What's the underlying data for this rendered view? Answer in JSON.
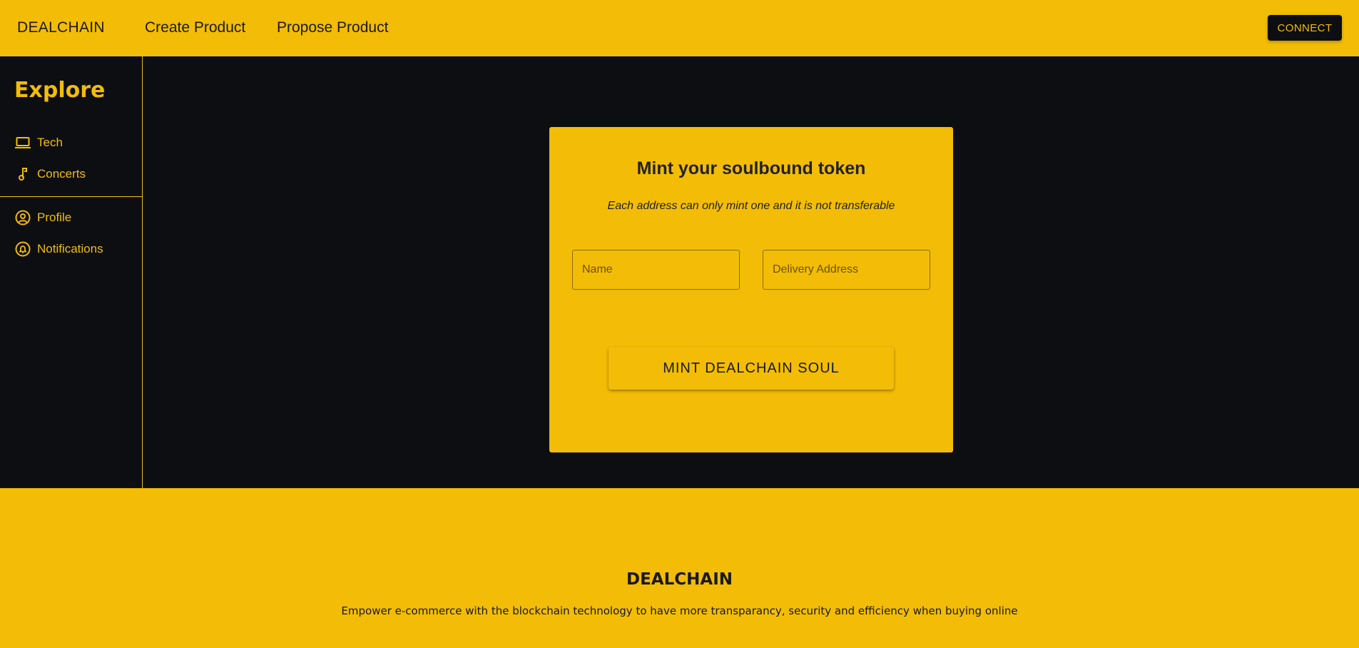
{
  "header": {
    "brand": "DEALCHAIN",
    "nav": [
      {
        "label": "Create Product"
      },
      {
        "label": "Propose Product"
      }
    ],
    "connect_label": "CONNECT"
  },
  "sidebar": {
    "title": "Explore",
    "items": [
      {
        "label": "Tech",
        "icon": "laptop-icon"
      },
      {
        "label": "Concerts",
        "icon": "music-note-icon"
      },
      {
        "label": "Profile",
        "icon": "account-circle-icon"
      },
      {
        "label": "Notifications",
        "icon": "bell-circle-icon"
      }
    ]
  },
  "mint_card": {
    "title": "Mint your soulbound token",
    "subtitle": "Each address can only mint one and it is not transferable",
    "name_placeholder": "Name",
    "address_placeholder": "Delivery Address",
    "mint_button": "MINT DEALCHAIN SOUL"
  },
  "footer": {
    "title": "DEALCHAIN",
    "tagline": "Empower e-commerce with the blockchain technology to have more transparancy, security and efficiency when buying online"
  },
  "colors": {
    "accent": "#f3bc06",
    "background": "#0d0e12",
    "text_dark": "#1a1a1a"
  }
}
